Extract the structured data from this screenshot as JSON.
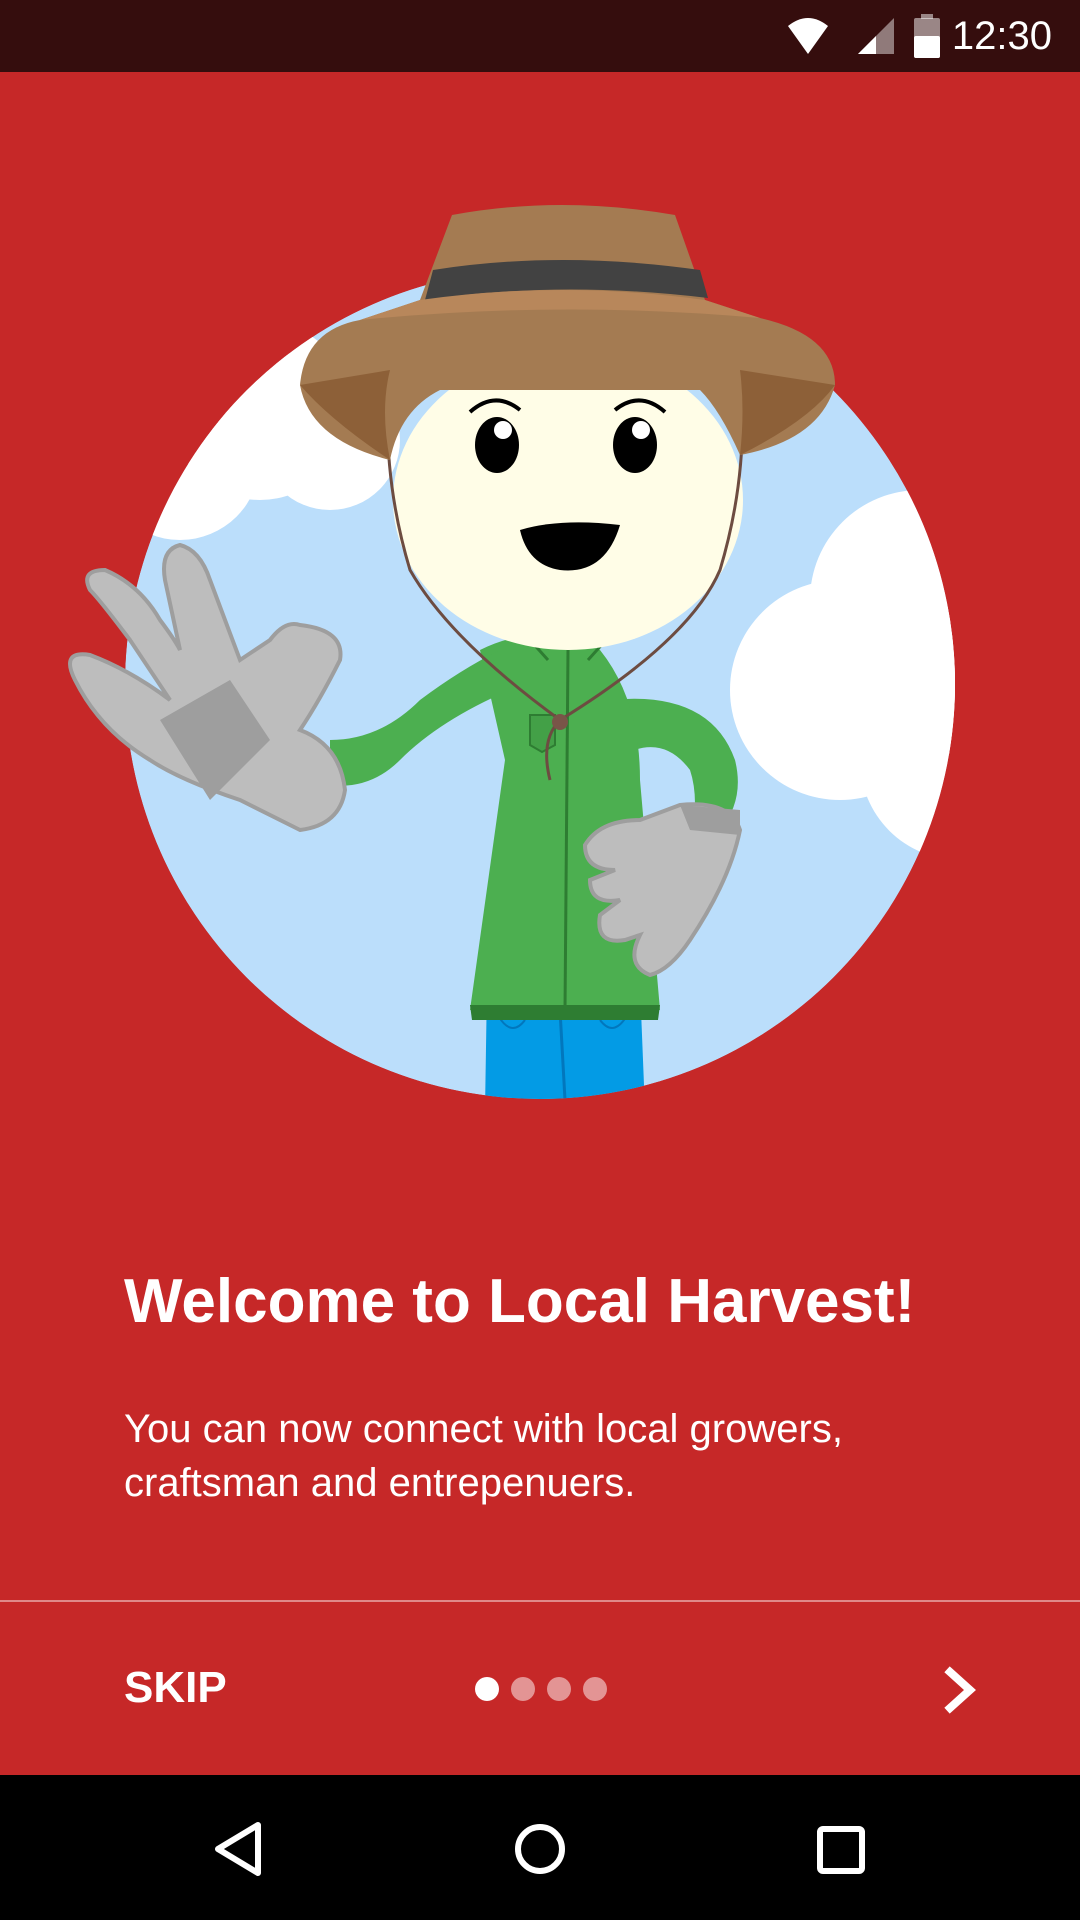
{
  "status_bar": {
    "time": "12:30",
    "icons": [
      "wifi-icon",
      "cell-signal-icon",
      "battery-icon"
    ]
  },
  "hero": {
    "illustration": "farmer-character-waving",
    "colors": {
      "sky": "#bbdefb",
      "hat": "#a47b52",
      "shirt": "#4caf50",
      "jeans": "#039be5",
      "gloves": "#bdbdbd",
      "face": "#fffde7"
    }
  },
  "onboarding": {
    "title": "Welcome to Local Harvest!",
    "body": "You can now connect with local growers, craftsman and entrepenuers."
  },
  "footer": {
    "skip_label": "SKIP",
    "page_count": 4,
    "active_page": 1,
    "next_icon": "chevron-right-icon"
  },
  "nav_bar": {
    "icons": [
      "back-icon",
      "home-icon",
      "recents-icon"
    ]
  },
  "colors": {
    "background": "#c62828",
    "status_bar": "#350d0d",
    "text": "#ffffff"
  }
}
